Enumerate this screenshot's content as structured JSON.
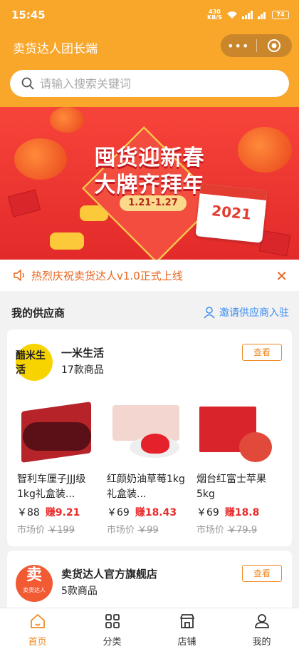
{
  "status": {
    "time": "15:45",
    "net_speed_value": "430",
    "net_speed_unit": "KB/S",
    "battery": "74"
  },
  "nav": {
    "title": "卖货达人团长端",
    "menu_dots": "•••"
  },
  "search": {
    "placeholder": "请输入搜索关键词"
  },
  "banner": {
    "line1": "囤货迎新春",
    "line2": "大牌齐拜年",
    "date_range": "1.21-1.27",
    "year": "2021"
  },
  "notice": {
    "text": "热烈庆祝卖货达人v1.0正式上线",
    "close": "✕"
  },
  "suppliers_section": {
    "title": "我的供应商",
    "invite_label": "邀请供应商入驻"
  },
  "stores": [
    {
      "name": "一米生活",
      "logo_text": "醋米生活",
      "count": "17款商品",
      "view_label": "查看",
      "products": [
        {
          "name": "智利车厘子JJJ级1kg礼盒装...",
          "price": "￥88",
          "earn": "赚9.21",
          "market_label": "市场价",
          "market_price": "￥199"
        },
        {
          "name": "红颜奶油草莓1kg礼盒装...",
          "price": "￥69",
          "earn": "赚18.43",
          "market_label": "市场价",
          "market_price": "￥99"
        },
        {
          "name": "烟台红富士苹果5kg",
          "price": "￥69",
          "earn": "赚18.8",
          "market_label": "市场价",
          "market_price": "￥79.9"
        }
      ]
    },
    {
      "name": "卖货达人官方旗舰店",
      "logo_big": "卖",
      "logo_small": "卖货达人",
      "count": "5款商品",
      "view_label": "查看"
    }
  ],
  "tabs": [
    {
      "label": "首页",
      "icon": "home-icon",
      "active": true
    },
    {
      "label": "分类",
      "icon": "grid-icon",
      "active": false
    },
    {
      "label": "店铺",
      "icon": "shop-icon",
      "active": false
    },
    {
      "label": "我的",
      "icon": "user-icon",
      "active": false
    }
  ],
  "colors": {
    "brand": "#f9a72b",
    "accent": "#f08a24",
    "earn": "#e82b2b",
    "link": "#3a8cf0"
  }
}
